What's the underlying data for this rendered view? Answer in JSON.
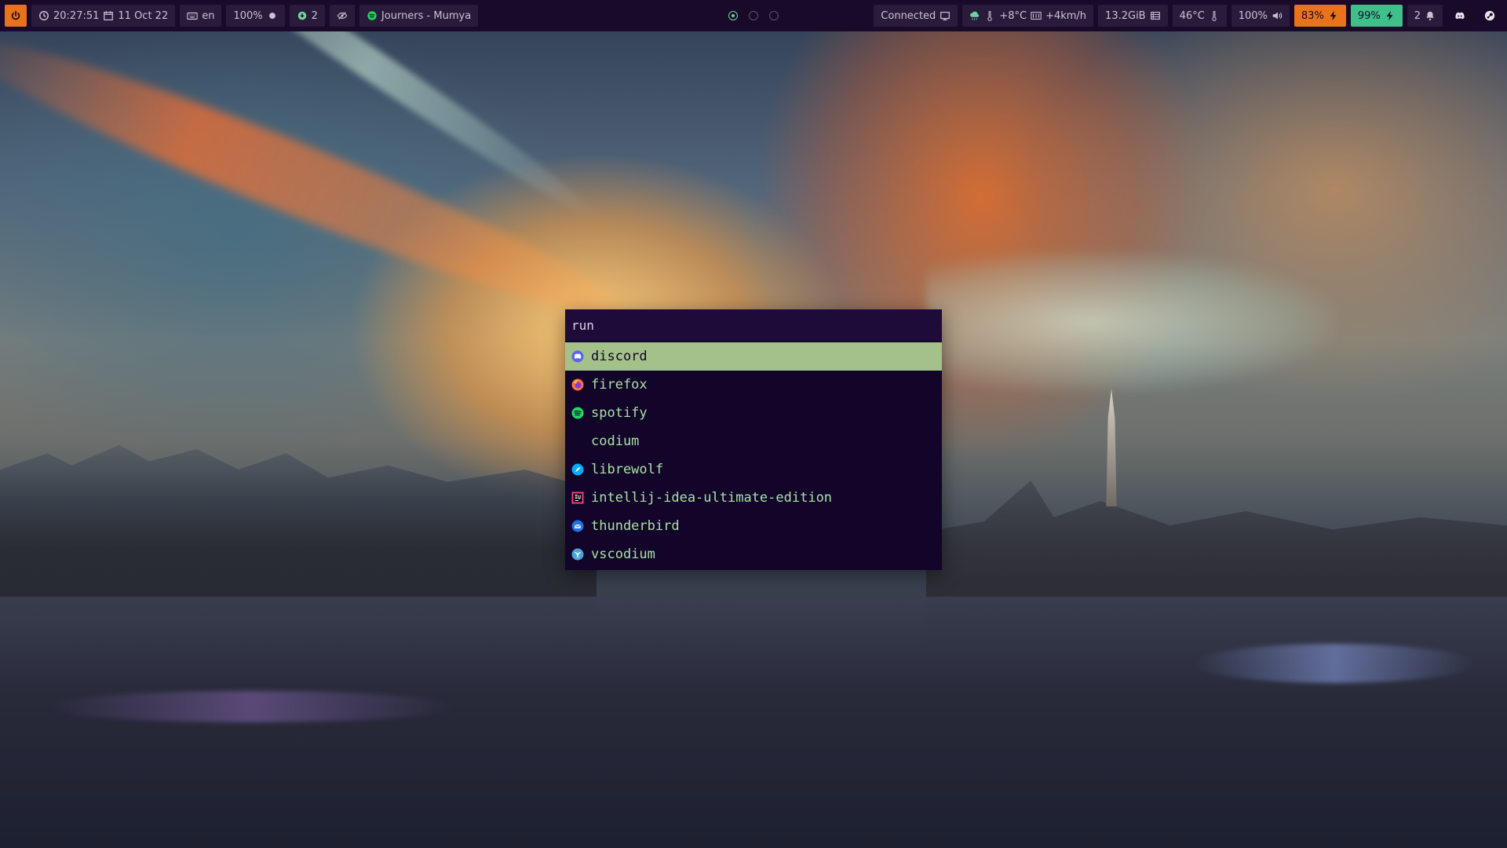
{
  "topbar": {
    "clock": "20:27:51",
    "date": "11 Oct 22",
    "keyboard_layout": "en",
    "brightness": "100%",
    "updates": "2",
    "now_playing": "Journers - Mumya",
    "workspaces": [
      {
        "id": 1,
        "active": true
      },
      {
        "id": 2,
        "active": false
      },
      {
        "id": 3,
        "active": false
      }
    ],
    "network": "Connected",
    "weather": "+8°C",
    "wind": "+4km/h",
    "memory": "13.2GiB",
    "cpu_temp": "46°C",
    "volume": "100%",
    "battery_1": "83%",
    "battery_2": "99%",
    "notifications": "2",
    "colors": {
      "bar_bg": "#1a0a2a",
      "accent_orange": "#e8731a",
      "accent_green": "#3fbf8a"
    }
  },
  "launcher": {
    "prompt": "run",
    "items": [
      {
        "label": "discord",
        "icon": "discord-icon",
        "selected": true
      },
      {
        "label": "firefox",
        "icon": "firefox-icon",
        "selected": false
      },
      {
        "label": "spotify",
        "icon": "spotify-icon",
        "selected": false
      },
      {
        "label": "codium",
        "icon": "",
        "selected": false
      },
      {
        "label": "librewolf",
        "icon": "librewolf-icon",
        "selected": false
      },
      {
        "label": "intellij-idea-ultimate-edition",
        "icon": "intellij-icon",
        "selected": false
      },
      {
        "label": "thunderbird",
        "icon": "thunderbird-icon",
        "selected": false
      },
      {
        "label": "vscodium",
        "icon": "vscodium-icon",
        "selected": false
      }
    ],
    "colors": {
      "bg": "#13042a",
      "selected_bg": "#a3c188",
      "text": "#a6e3a1"
    }
  }
}
